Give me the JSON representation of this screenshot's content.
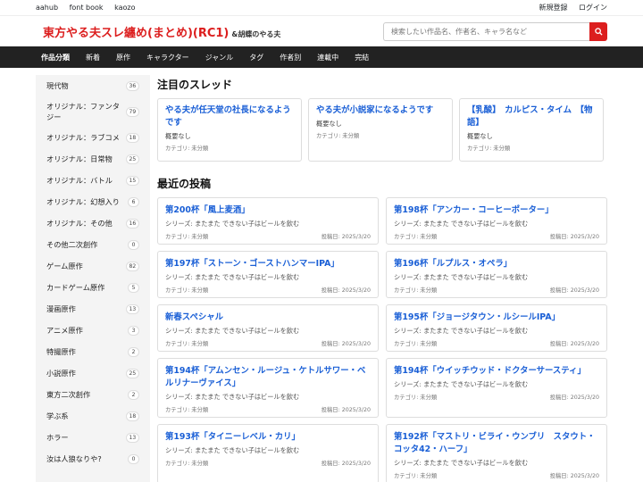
{
  "topbar": {
    "left": [
      "aahub",
      "font book",
      "kaozo"
    ],
    "right": [
      "新規登録",
      "ログイン"
    ]
  },
  "header": {
    "brand_main": "東方やる夫スレ纏め(まとめ)(RC1)",
    "brand_sub": "&胡蝶のやる夫",
    "search_placeholder": "検索したい作品名、作者名、キャラ名など"
  },
  "nav": [
    "作品分類",
    "新着",
    "原作",
    "キャラクター",
    "ジャンル",
    "タグ",
    "作者別",
    "連載中",
    "完結"
  ],
  "sidebar": [
    {
      "label": "現代物",
      "count": "36"
    },
    {
      "label": "オリジナル：ファンタジー",
      "count": "79"
    },
    {
      "label": "オリジナル：ラブコメ",
      "count": "18"
    },
    {
      "label": "オリジナル：日常物",
      "count": "25"
    },
    {
      "label": "オリジナル：バトル",
      "count": "15"
    },
    {
      "label": "オリジナル：幻想入り",
      "count": "6"
    },
    {
      "label": "オリジナル：その他",
      "count": "16"
    },
    {
      "label": "その他二次創作",
      "count": "0"
    },
    {
      "label": "ゲーム原作",
      "count": "82"
    },
    {
      "label": "カードゲーム原作",
      "count": "5"
    },
    {
      "label": "漫画原作",
      "count": "13"
    },
    {
      "label": "アニメ原作",
      "count": "3"
    },
    {
      "label": "特撮原作",
      "count": "2"
    },
    {
      "label": "小説原作",
      "count": "25"
    },
    {
      "label": "東方二次創作",
      "count": "2"
    },
    {
      "label": "学ぶ系",
      "count": "18"
    },
    {
      "label": "ホラー",
      "count": "13"
    },
    {
      "label": "汝は人狼なりや?",
      "count": "0"
    }
  ],
  "featured": {
    "title": "注目のスレッド",
    "items": [
      {
        "title": "やる夫が任天堂の社長になるようです",
        "desc": "概要なし",
        "cat": "カテゴリ: 未分類"
      },
      {
        "title": "やる夫が小説家になるようです",
        "desc": "概要なし",
        "cat": "カテゴリ: 未分類"
      },
      {
        "title": "【乳酸】　カルピス・タイム　【物語】",
        "desc": "概要なし",
        "cat": "カテゴリ: 未分類"
      }
    ]
  },
  "recent": {
    "title": "最近の投稿",
    "items": [
      {
        "title": "第200杯「風上麦酒」",
        "series": "シリーズ: またまた できない子はビールを飲む",
        "cat": "カテゴリ: 未分類",
        "date": "投稿日: 2025/3/20"
      },
      {
        "title": "第198杯「アンカー・コーヒーポーター」",
        "series": "シリーズ: またまた できない子はビールを飲む",
        "cat": "カテゴリ: 未分類",
        "date": "投稿日: 2025/3/20"
      },
      {
        "title": "第197杯「ストーン・ゴーストハンマーIPA」",
        "series": "シリーズ: またまた できない子はビールを飲む",
        "cat": "カテゴリ: 未分類",
        "date": "投稿日: 2025/3/20"
      },
      {
        "title": "第196杯「ルプルス・オペラ」",
        "series": "シリーズ: またまた できない子はビールを飲む",
        "cat": "カテゴリ: 未分類",
        "date": "投稿日: 2025/3/20"
      },
      {
        "title": "新春スペシャル",
        "series": "シリーズ: またまた できない子はビールを飲む",
        "cat": "カテゴリ: 未分類",
        "date": "投稿日: 2025/3/20"
      },
      {
        "title": "第195杯「ジョージタウン・ルシールIPA」",
        "series": "シリーズ: またまた できない子はビールを飲む",
        "cat": "カテゴリ: 未分類",
        "date": "投稿日: 2025/3/20"
      },
      {
        "title": "第194杯「アムンセン・ルージュ・ケトルサワー・ベルリナーヴァイス」",
        "series": "シリーズ: またまた できない子はビールを飲む",
        "cat": "カテゴリ: 未分類",
        "date": "投稿日: 2025/3/20"
      },
      {
        "title": "第194杯「ウイッチウッド・ドクターサースティ」",
        "series": "シリーズ: またまた できない子はビールを飲む",
        "cat": "カテゴリ: 未分類",
        "date": "投稿日: 2025/3/20"
      },
      {
        "title": "第193杯「タイニーレベル・カリ」",
        "series": "シリーズ: またまた できない子はビールを飲む",
        "cat": "カテゴリ: 未分類",
        "date": "投稿日: 2025/3/20"
      },
      {
        "title": "第192杯「マストリ・ビライ・ウンブリ　スタウト・コッタ42・ハーフ」",
        "series": "シリーズ: またまた できない子はビールを飲む",
        "cat": "カテゴリ: 未分類",
        "date": "投稿日: 2025/3/20"
      }
    ]
  }
}
